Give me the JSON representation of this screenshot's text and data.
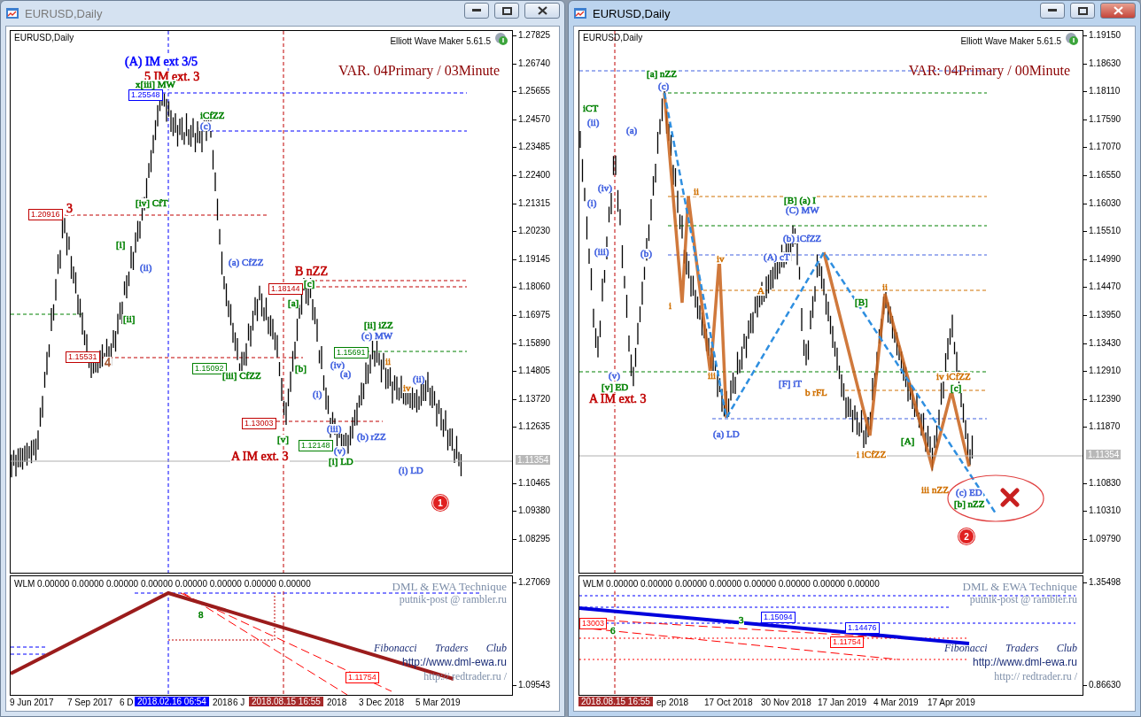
{
  "windows": [
    {
      "title": "EURUSD,Daily",
      "active": false,
      "chart": {
        "symbol": "EURUSD,Daily",
        "indicator": "Elliott Wave Maker 5.61.5",
        "variant": "VAR. 04Primary / 03Minute",
        "marker": "1",
        "price_axis": [
          "1.27825",
          "1.26740",
          "1.25655",
          "1.24570",
          "1.23485",
          "1.22400",
          "1.21315",
          "1.20230",
          "1.19145",
          "1.18060",
          "1.16975",
          "1.15890",
          "1.14805",
          "1.13720",
          "1.12635",
          "1.10465",
          "1.09380",
          "1.08295"
        ],
        "current_price": "1.11354",
        "wave_labels": [
          {
            "text": "(A) IM ext 3/5",
            "color": "#0000ff",
            "kind": "caption"
          },
          {
            "text": "5 IM ext. 3",
            "color": "#c00000",
            "kind": "caption"
          },
          {
            "text": "x[iii] MW",
            "color": "#008000",
            "kind": "wave"
          },
          {
            "text": "iCfZZ",
            "color": "#008000",
            "kind": "wave"
          },
          {
            "text": "(c)",
            "color": "#4060e0",
            "kind": "wave"
          },
          {
            "text": "3",
            "color": "#c00000",
            "kind": "caption"
          },
          {
            "text": "[iv] CfT",
            "color": "#008000",
            "kind": "wave"
          },
          {
            "text": "[i]",
            "color": "#008000",
            "kind": "wave"
          },
          {
            "text": "(ii)",
            "color": "#4060e0",
            "kind": "wave"
          },
          {
            "text": "[ii]",
            "color": "#008000",
            "kind": "wave"
          },
          {
            "text": "4",
            "color": "#a0522d",
            "kind": "caption"
          },
          {
            "text": "(a) CfZZ",
            "color": "#4060e0",
            "kind": "wave"
          },
          {
            "text": "B nZZ",
            "color": "#c00000",
            "kind": "caption"
          },
          {
            "text": "[c]",
            "color": "#008000",
            "kind": "wave"
          },
          {
            "text": "[a]",
            "color": "#008000",
            "kind": "wave"
          },
          {
            "text": "[b]",
            "color": "#008000",
            "kind": "wave"
          },
          {
            "text": "[iii] CfZZ",
            "color": "#008000",
            "kind": "wave"
          },
          {
            "text": "(iii)",
            "color": "#4060e0",
            "kind": "wave"
          },
          {
            "text": "[v]",
            "color": "#008000",
            "kind": "wave"
          },
          {
            "text": "(v)",
            "color": "#4060e0",
            "kind": "wave"
          },
          {
            "text": "[i] LD",
            "color": "#008000",
            "kind": "wave"
          },
          {
            "text": "A IM ext. 3",
            "color": "#c00000",
            "kind": "caption"
          },
          {
            "text": "[ii] iZZ",
            "color": "#008000",
            "kind": "wave"
          },
          {
            "text": "(c) MW",
            "color": "#4060e0",
            "kind": "wave"
          },
          {
            "text": "(iv)",
            "color": "#4060e0",
            "kind": "wave"
          },
          {
            "text": "(a)",
            "color": "#4060e0",
            "kind": "wave"
          },
          {
            "text": "(b) rZZ",
            "color": "#4060e0",
            "kind": "wave"
          },
          {
            "text": "(ii)",
            "color": "#4060e0",
            "kind": "wave"
          },
          {
            "text": "iv",
            "color": "#d07000",
            "kind": "wave"
          },
          {
            "text": "ii",
            "color": "#d07000",
            "kind": "wave"
          },
          {
            "text": "(i)",
            "color": "#4060e0",
            "kind": "wave"
          },
          {
            "text": "(i) LD",
            "color": "#4060e0",
            "kind": "wave"
          }
        ],
        "price_tags": [
          {
            "text": "1.25548",
            "color": "#0000ff"
          },
          {
            "text": "1.20916",
            "color": "#c00000"
          },
          {
            "text": "1.15531",
            "color": "#c00000"
          },
          {
            "text": "1.15092",
            "color": "#008000"
          },
          {
            "text": "1.18144",
            "color": "#c00000"
          },
          {
            "text": "1.13003",
            "color": "#c00000"
          },
          {
            "text": "1.12148",
            "color": "#008000"
          },
          {
            "text": "1.15691",
            "color": "#008000"
          }
        ]
      },
      "subwindow": {
        "readout": "WLM 0.00000 0.00000 0.00000 0.00000 0.00000 0.00000 0.00000 0.00000",
        "axis": [
          "1.27069",
          "1.09543"
        ],
        "tags": [
          {
            "text": "8",
            "color": "#008000"
          },
          {
            "text": "1.11754",
            "color": "#ff0000"
          }
        ],
        "credits": [
          "DML & EWA Technique",
          "putnik-post @ rambler.ru",
          "Fibonacci Traders Club",
          "http://www.dml-ewa.ru",
          "http:// redtrader.ru /"
        ]
      },
      "time_axis": {
        "labels": [
          "9 Jun 2017",
          "7 Sep 2017",
          "6 D",
          "2018",
          "6 J",
          "2018",
          "3 Dec 2018",
          "5 Mar 2019"
        ],
        "cursors": [
          {
            "text": "2018.02.16 06:54",
            "color": "#0000ff"
          },
          {
            "text": "2018.08.15 16:55",
            "color": "#a52a2a"
          }
        ]
      }
    },
    {
      "title": "EURUSD,Daily",
      "active": true,
      "chart": {
        "symbol": "EURUSD,Daily",
        "indicator": "Elliott Wave Maker 5.61.5",
        "variant": "VAR: 04Primary / 00Minute",
        "rejected": true,
        "marker": "2",
        "price_axis": [
          "1.19150",
          "1.18630",
          "1.18110",
          "1.17590",
          "1.17070",
          "1.16550",
          "1.16030",
          "1.15510",
          "1.14990",
          "1.14470",
          "1.13950",
          "1.13430",
          "1.12910",
          "1.12390",
          "1.11870",
          "1.10830",
          "1.10310",
          "1.09790"
        ],
        "current_price": "1.11354",
        "wave_labels": [
          {
            "text": "[a] nZZ",
            "color": "#008000",
            "kind": "wave"
          },
          {
            "text": "(c)",
            "color": "#4060e0",
            "kind": "wave"
          },
          {
            "text": "iCT",
            "color": "#008000",
            "kind": "wave"
          },
          {
            "text": "(ii)",
            "color": "#4060e0",
            "kind": "wave"
          },
          {
            "text": "(a)",
            "color": "#4060e0",
            "kind": "wave"
          },
          {
            "text": "(iv)",
            "color": "#4060e0",
            "kind": "wave"
          },
          {
            "text": "(i)",
            "color": "#4060e0",
            "kind": "wave"
          },
          {
            "text": "(iii)",
            "color": "#4060e0",
            "kind": "wave"
          },
          {
            "text": "(b)",
            "color": "#4060e0",
            "kind": "wave"
          },
          {
            "text": "(v)",
            "color": "#4060e0",
            "kind": "wave"
          },
          {
            "text": "[v] ED",
            "color": "#008000",
            "kind": "wave"
          },
          {
            "text": "A IM ext. 3",
            "color": "#c00000",
            "kind": "caption"
          },
          {
            "text": "ii",
            "color": "#d07000",
            "kind": "wave"
          },
          {
            "text": "i",
            "color": "#d07000",
            "kind": "wave"
          },
          {
            "text": "iv",
            "color": "#d07000",
            "kind": "wave"
          },
          {
            "text": "iii",
            "color": "#d07000",
            "kind": "wave"
          },
          {
            "text": "(a) LD",
            "color": "#4060e0",
            "kind": "wave"
          },
          {
            "text": "[B] (a) I",
            "color": "#008000",
            "kind": "wave"
          },
          {
            "text": "(C) MW",
            "color": "#4060e0",
            "kind": "wave"
          },
          {
            "text": "(b) iCfZZ",
            "color": "#4060e0",
            "kind": "wave"
          },
          {
            "text": "(A) cT",
            "color": "#4060e0",
            "kind": "wave"
          },
          {
            "text": "A",
            "color": "#d07000",
            "kind": "wave"
          },
          {
            "text": "[F] iT",
            "color": "#4060e0",
            "kind": "wave"
          },
          {
            "text": "b rFL",
            "color": "#d07000",
            "kind": "wave"
          },
          {
            "text": "[B]",
            "color": "#008000",
            "kind": "wave"
          },
          {
            "text": "ii",
            "color": "#d07000",
            "kind": "wave"
          },
          {
            "text": "i iCfZZ",
            "color": "#d07000",
            "kind": "wave"
          },
          {
            "text": "[A]",
            "color": "#008000",
            "kind": "wave"
          },
          {
            "text": "iv iCfZZ",
            "color": "#d07000",
            "kind": "wave"
          },
          {
            "text": "[c]",
            "color": "#008000",
            "kind": "wave"
          },
          {
            "text": "iii nZZ",
            "color": "#d07000",
            "kind": "wave"
          },
          {
            "text": "(c) ED",
            "color": "#4060e0",
            "kind": "wave"
          },
          {
            "text": "[b] nZZ",
            "color": "#008000",
            "kind": "wave"
          }
        ]
      },
      "subwindow": {
        "readout": "WLM 0.00000 0.00000 0.00000 0.00000 0.00000 0.00000 0.00000 0.00000",
        "axis": [
          "1.35498",
          "0.86630"
        ],
        "tags": [
          {
            "text": "13003",
            "color": "#ff0000"
          },
          {
            "text": "6",
            "color": "#008000"
          },
          {
            "text": "3",
            "color": "#008000"
          },
          {
            "text": "1.15094",
            "color": "#0000ff"
          },
          {
            "text": "1.14476",
            "color": "#0000ff"
          },
          {
            "text": "1.11754",
            "color": "#ff0000"
          }
        ],
        "credits": [
          "DML & EWA Technique",
          "putnik-post @ rambler.ru",
          "Fibonacci Traders Club",
          "http://www.dml-ewa.ru",
          "http:// redtrader.ru /"
        ]
      },
      "time_axis": {
        "labels": [
          "ep 2018",
          "17 Oct 2018",
          "30 Nov 2018",
          "17 Jan 2019",
          "4 Mar 2019",
          "17 Apr 2019"
        ],
        "cursors": [
          {
            "text": "2018.08.15 16:55",
            "color": "#a52a2a"
          }
        ]
      }
    }
  ]
}
